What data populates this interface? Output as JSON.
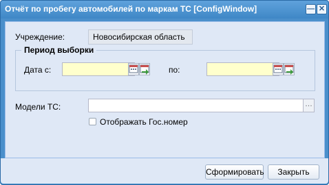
{
  "window": {
    "title": "Отчёт по пробегу автомобилей по маркам ТС [ConfigWindow]",
    "minimize_glyph": "—",
    "close_glyph": "✕"
  },
  "form": {
    "institution_label": "Учреждение:",
    "institution_value": "Новосибирская область",
    "period_legend": "Период выборки",
    "date_from_label": "Дата с:",
    "date_from_value": "",
    "date_to_label": "по:",
    "date_to_value": "",
    "models_label": "Модели ТС:",
    "models_value": "",
    "models_trigger": "…",
    "show_plate_label": "Отображать Гос.номер",
    "show_plate_checked": false
  },
  "footer": {
    "generate_label": "Сформировать",
    "close_label": "Закрыть"
  }
}
